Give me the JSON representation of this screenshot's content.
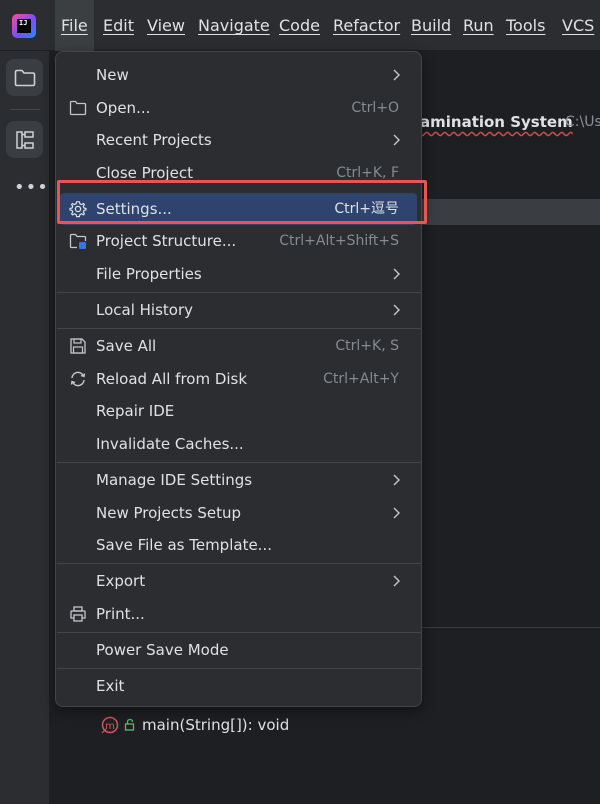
{
  "menubar": {
    "items": [
      "File",
      "Edit",
      "View",
      "Navigate",
      "Code",
      "Refactor",
      "Build",
      "Run",
      "Tools",
      "VCS"
    ],
    "active": "File"
  },
  "background": {
    "project_title": "amination System",
    "project_path": "C:\\Us",
    "structure_item": "main(String[]): void"
  },
  "file_menu": {
    "items": [
      {
        "label": "New",
        "submenu": true
      },
      {
        "label": "Open...",
        "shortcut": "Ctrl+O",
        "icon": "folder-icon"
      },
      {
        "label": "Recent Projects",
        "submenu": true
      },
      {
        "label": "Close Project",
        "shortcut": "Ctrl+K, F"
      },
      {
        "label": "Settings...",
        "shortcut": "Ctrl+逗号",
        "icon": "gear-icon",
        "selected": true
      },
      {
        "label": "Project Structure...",
        "shortcut": "Ctrl+Alt+Shift+S",
        "icon": "project-structure-icon"
      },
      {
        "label": "File Properties",
        "submenu": true
      },
      {
        "label": "Local History",
        "submenu": true
      },
      {
        "label": "Save All",
        "shortcut": "Ctrl+K, S",
        "icon": "save-icon"
      },
      {
        "label": "Reload All from Disk",
        "shortcut": "Ctrl+Alt+Y",
        "icon": "reload-icon"
      },
      {
        "label": "Repair IDE"
      },
      {
        "label": "Invalidate Caches..."
      },
      {
        "label": "Manage IDE Settings",
        "submenu": true
      },
      {
        "label": "New Projects Setup",
        "submenu": true
      },
      {
        "label": "Save File as Template..."
      },
      {
        "label": "Export",
        "submenu": true
      },
      {
        "label": "Print...",
        "icon": "printer-icon"
      },
      {
        "label": "Power Save Mode"
      },
      {
        "label": "Exit"
      }
    ]
  },
  "colors": {
    "menu_bg": "#2b2d30",
    "selection": "#2e436e",
    "highlight_box": "#e85555"
  }
}
